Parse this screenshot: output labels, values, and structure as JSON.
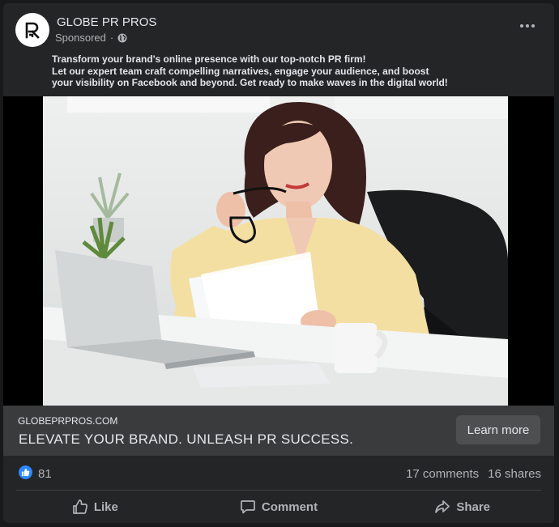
{
  "post": {
    "page_name": "GLOBE PR PROS",
    "sponsored_label": "Sponsored",
    "meta_separator": "·",
    "logo_letter": "R",
    "caption_lines": [
      "Transform your brand's online presence with our top-notch PR firm!",
      "Let our expert team craft compelling narratives, engage your audience, and boost",
      "your visibility on Facebook and beyond. Get ready to make waves in the digital world!"
    ]
  },
  "link": {
    "domain": "GLOBEPRPROS.COM",
    "headline": "ELEVATE YOUR BRAND. UNLEASH PR SUCCESS.",
    "cta_label": "Learn more"
  },
  "stats": {
    "reactions": "81",
    "comments": "17 comments",
    "shares": "16 shares"
  },
  "actions": {
    "like": "Like",
    "comment": "Comment",
    "share": "Share"
  },
  "icons": [
    "globe-icon",
    "more-options-icon",
    "thumbs-up-icon",
    "comment-icon",
    "share-icon"
  ],
  "colors": {
    "card_bg": "#242526",
    "link_bar_bg": "#3a3b3c",
    "primary_text": "#e4e6eb",
    "secondary_text": "#b0b3b8",
    "like_blue": "#2d88ff"
  }
}
